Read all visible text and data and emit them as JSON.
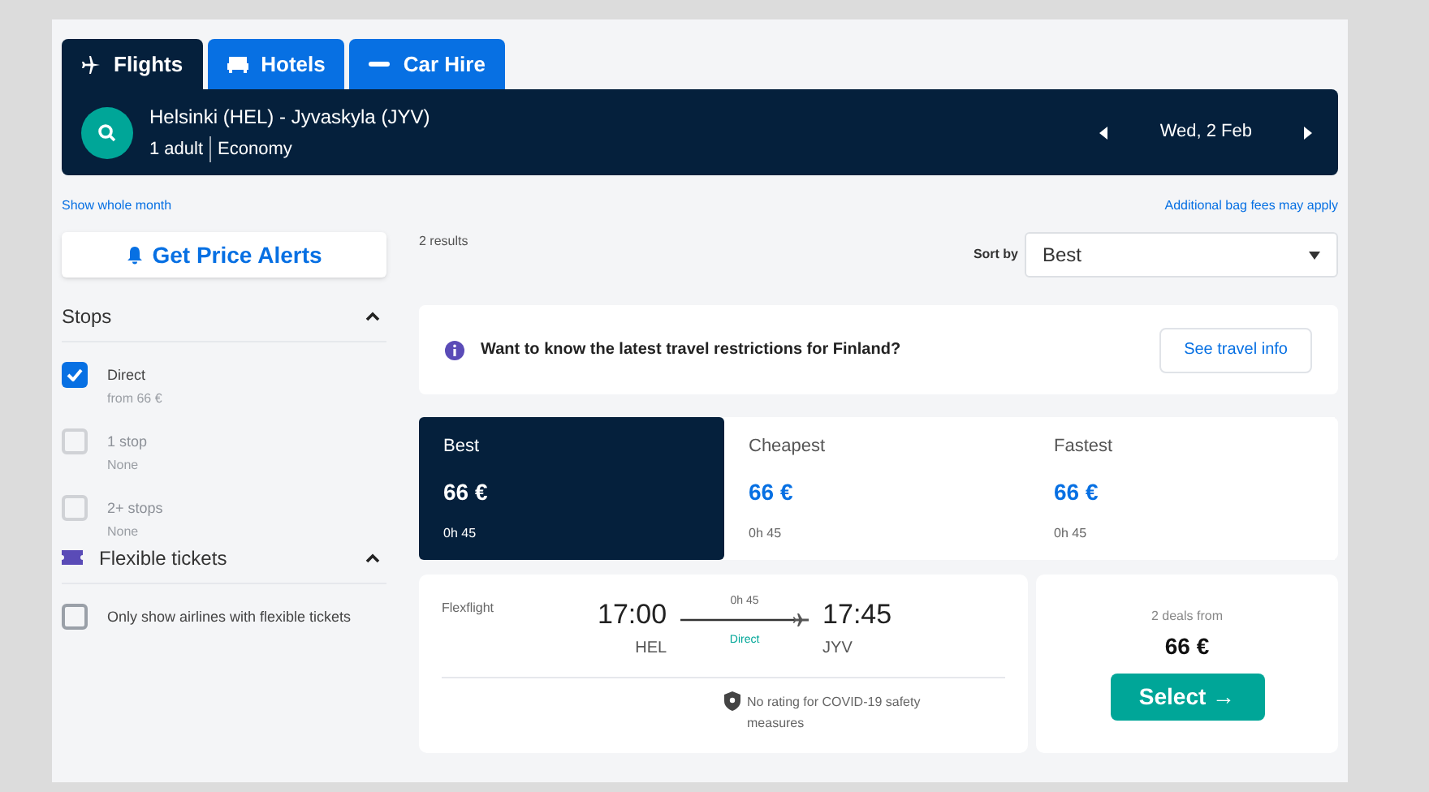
{
  "tabs": [
    {
      "label": "Flights",
      "selected": true
    },
    {
      "label": "Hotels",
      "selected": false
    },
    {
      "label": "Car Hire",
      "selected": false
    }
  ],
  "search": {
    "route": "Helsinki (HEL) - Jyvaskyla (JYV)",
    "travellers": "1 adult",
    "cabin": "Economy",
    "date": "Wed, 2 Feb"
  },
  "show_whole_month": "Show whole month",
  "bag_fees": "Additional bag fees may apply",
  "price_alerts": "Get Price Alerts",
  "results_count": "2 results",
  "sort": {
    "label": "Sort by",
    "value": "Best"
  },
  "filters": [
    {
      "title": "Stops",
      "expanded": true,
      "options": [
        {
          "label": "Direct",
          "sub": "from 66 €",
          "checked": true,
          "disabled": false
        },
        {
          "label": "1 stop",
          "sub": "None",
          "checked": false,
          "disabled": true
        },
        {
          "label": "2+ stops",
          "sub": "None",
          "checked": false,
          "disabled": true
        }
      ]
    },
    {
      "title": "Flexible tickets",
      "expanded": true,
      "options": [
        {
          "label": "Only show airlines with flexible tickets",
          "checked": false,
          "disabled": false
        }
      ]
    }
  ],
  "notice": {
    "text": "Want to know the latest travel restrictions for Finland?",
    "button": "See travel info"
  },
  "sort_tabs": [
    {
      "label": "Best",
      "price": "66 €",
      "duration": "0h 45",
      "selected": true
    },
    {
      "label": "Cheapest",
      "price": "66 €",
      "duration": "0h 45",
      "selected": false
    },
    {
      "label": "Fastest",
      "price": "66 €",
      "duration": "0h 45",
      "selected": false
    }
  ],
  "result": {
    "airline": "Flexflight",
    "depart_time": "17:00",
    "depart_code": "HEL",
    "duration": "0h 45",
    "stops": "Direct",
    "arrive_time": "17:45",
    "arrive_code": "JYV",
    "covid": "No rating for COVID-19 safety measures",
    "deals": "2 deals from",
    "price": "66 €",
    "select": "Select →"
  }
}
